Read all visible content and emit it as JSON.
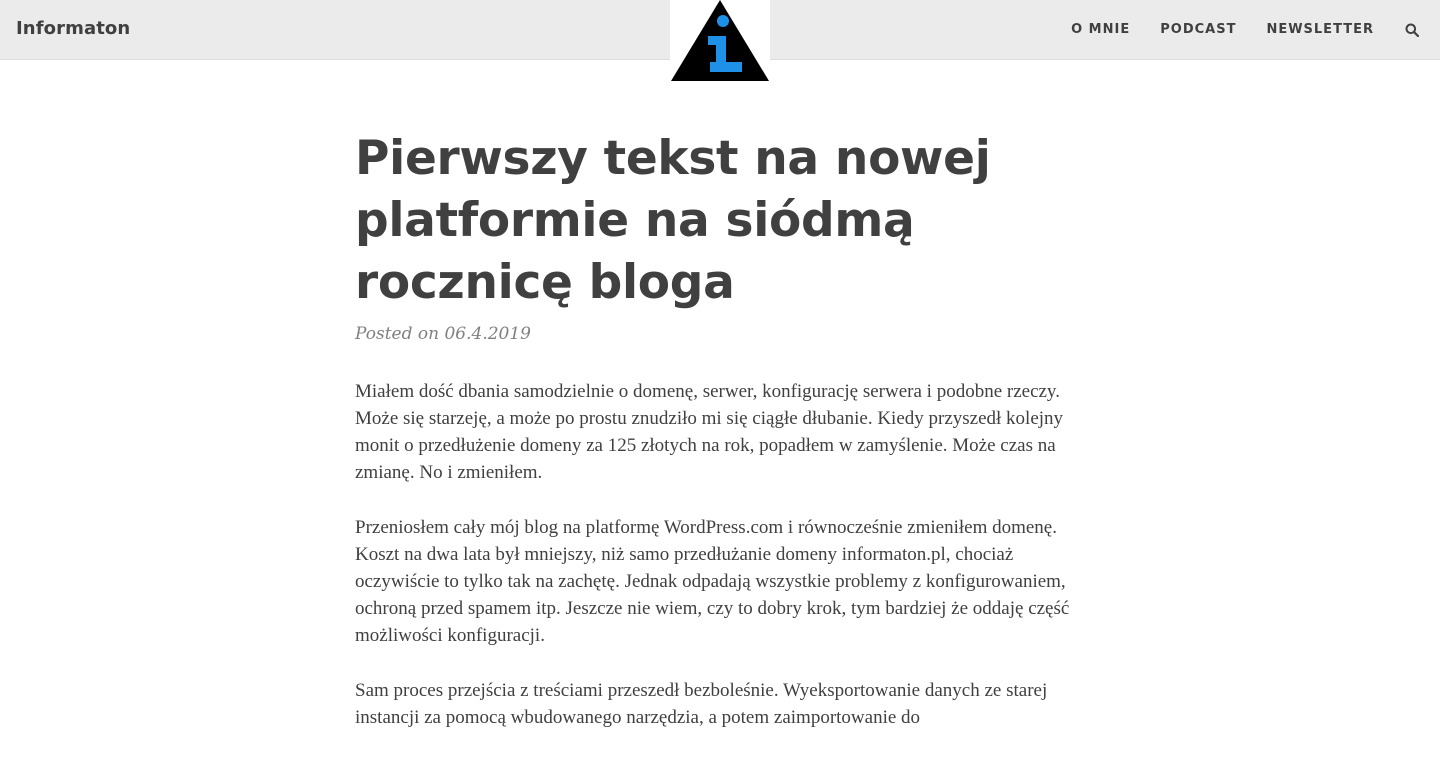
{
  "header": {
    "brand": "Informaton",
    "nav": [
      {
        "label": "O MNIE"
      },
      {
        "label": "PODCAST"
      },
      {
        "label": "NEWSLETTER"
      }
    ]
  },
  "post": {
    "title": "Pierwszy tekst na nowej platformie na siódmą rocznicę bloga",
    "meta": "Posted on 06.4.2019",
    "paragraphs": [
      "Miałem dość dbania samodzielnie o domenę, serwer, konfigurację serwera i podobne rzeczy. Może się starzeję, a może po prostu znudziło mi się ciągłe dłubanie. Kiedy przyszedł kolejny monit o przedłużenie domeny za 125 złotych na rok, popadłem w zamyślenie. Może czas na zmianę. No i zmieniłem.",
      "Przeniosłem cały mój blog na platformę WordPress.com i równocześnie zmieniłem domenę. Koszt na dwa lata był mniejszy, niż samo przedłużanie domeny informaton.pl, chociaż oczywiście to tylko tak na zachętę. Jednak odpadają wszystkie problemy z konfigurowaniem, ochroną przed spamem itp. Jeszcze nie wiem, czy to dobry krok, tym bardziej że oddaję część możliwości konfiguracji.",
      "Sam proces przejścia z treściami przeszedł bezboleśnie. Wyeksportowanie danych ze starej instancji za pomocą wbudowanego narzędzia, a potem zaimportowanie do"
    ]
  },
  "colors": {
    "header_bg": "#ebebeb",
    "text": "#404040",
    "meta": "#808080",
    "logo_triangle": "#000000",
    "logo_glyph": "#1e90e8"
  }
}
